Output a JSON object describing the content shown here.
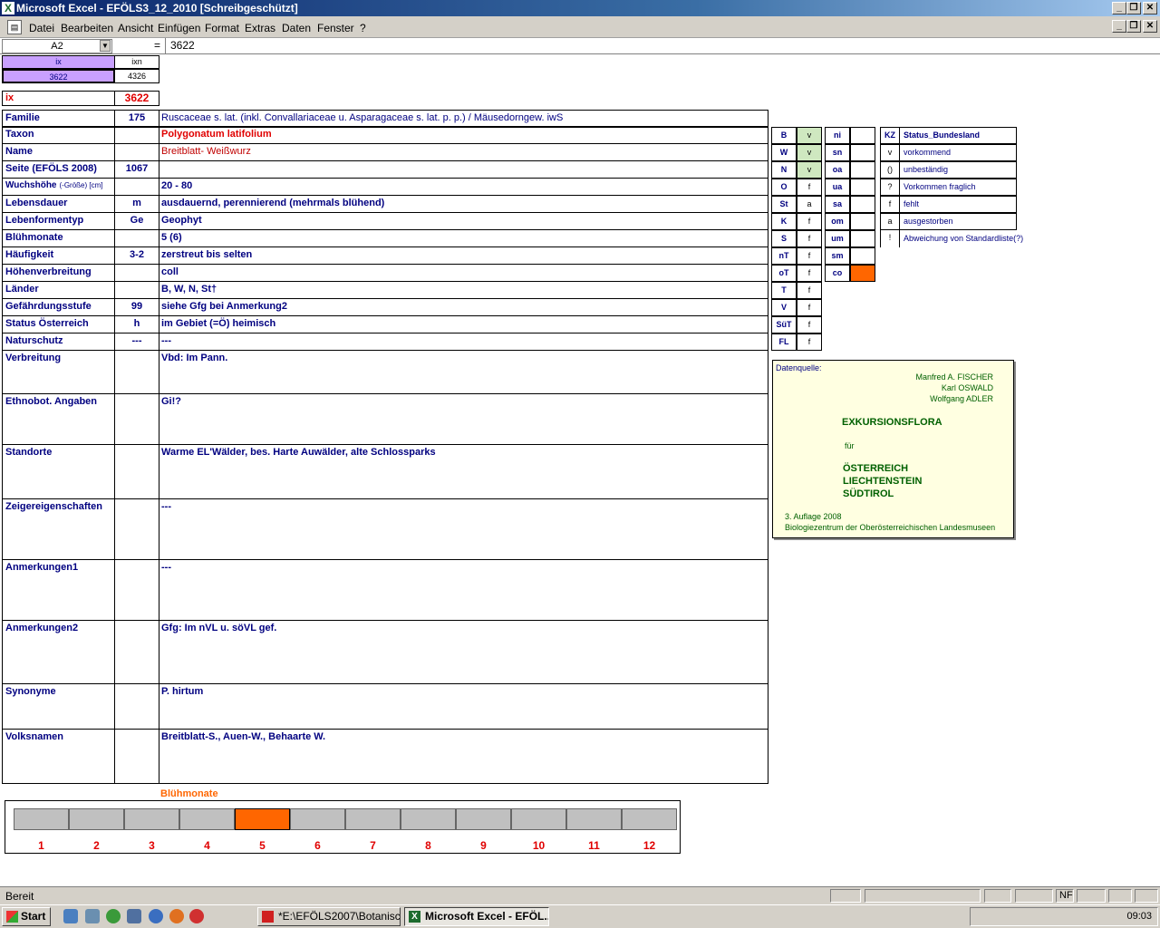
{
  "window": {
    "title": "Microsoft Excel - EFÖLS3_12_2010  [Schreibgeschützt]"
  },
  "menu": [
    "Datei",
    "Bearbeiten",
    "Ansicht",
    "Einfügen",
    "Format",
    "Extras",
    "Daten",
    "Fenster",
    "?"
  ],
  "formula": {
    "cell": "A2",
    "eq": "=",
    "value": "3622"
  },
  "header": {
    "ix_label": "ix",
    "ixn_label": "ixn",
    "ix_val": "3622",
    "ixn_val": "4326",
    "ix2_label": "ix",
    "ix2_val": "3622"
  },
  "rows": [
    {
      "label": "Familie",
      "code": "175",
      "value": "Ruscaceae s. lat. (inkl. Convallariaceae u. Asparagaceae s. lat. p. p.)  /  Mäusedorngew. iwS"
    },
    {
      "label": "Taxon",
      "code": "",
      "value": "Polygonatum latifolium"
    },
    {
      "label": "Name",
      "code": "",
      "value": "Breitblatt- Weißwurz"
    },
    {
      "label": "Seite (EFÖLS 2008)",
      "code": "1067",
      "value": ""
    },
    {
      "label": "Wuchshöhe",
      "label_suffix": "(-Größe) [cm]",
      "code": "",
      "value": "20 - 80"
    },
    {
      "label": "Lebensdauer",
      "code": "m",
      "value": "ausdauernd, perennierend (mehrmals blühend)"
    },
    {
      "label": "Lebenformentyp",
      "code": "Ge",
      "value": "Geophyt"
    },
    {
      "label": "Blühmonate",
      "code": "",
      "value": "5 (6)"
    },
    {
      "label": "Häufigkeit",
      "code": "3-2",
      "value": "zerstreut bis selten"
    },
    {
      "label": "Höhenverbreitung",
      "code": "",
      "value": "coll"
    },
    {
      "label": "Länder",
      "code": "",
      "value": "B, W, N, St†"
    },
    {
      "label": "Gefährdungsstufe",
      "code": "99",
      "value": "siehe Gfg bei Anmerkung2"
    },
    {
      "label": "Status Österreich",
      "code": "h",
      "value": "im Gebiet (=Ö) heimisch"
    },
    {
      "label": "Naturschutz",
      "code": "---",
      "value": "---"
    }
  ],
  "blocks": [
    {
      "label": "Verbreitung",
      "value": "Vbd:  Im Pann."
    },
    {
      "label": "Ethnobot. Angaben",
      "value": " Gi!?"
    },
    {
      "label": "Standorte",
      "value": "Warme EL'Wälder, bes. Harte Auwälder, alte Schlossparks"
    },
    {
      "label": "Zeigereigenschaften",
      "value": "---"
    },
    {
      "label": "Anmerkungen1",
      "value": "---"
    },
    {
      "label": "Anmerkungen2",
      "value": "Gfg: Im nVL u. söVL gef."
    },
    {
      "label": "Synonyme",
      "value": "P. hirtum"
    },
    {
      "label": "Volksnamen",
      "value": "Breitblatt-S., Auen-W., Behaarte W."
    }
  ],
  "laender": [
    {
      "code": "B",
      "status": "v"
    },
    {
      "code": "W",
      "status": "v"
    },
    {
      "code": "N",
      "status": "v"
    },
    {
      "code": "O",
      "status": "f"
    },
    {
      "code": "St",
      "status": "a"
    },
    {
      "code": "K",
      "status": "f"
    },
    {
      "code": "S",
      "status": "f"
    },
    {
      "code": "nT",
      "status": "f"
    },
    {
      "code": "oT",
      "status": "f"
    },
    {
      "code": "T",
      "status": "f"
    },
    {
      "code": "V",
      "status": "f"
    },
    {
      "code": "SüT",
      "status": "f"
    },
    {
      "code": "FL",
      "status": "f"
    }
  ],
  "regionen": [
    "ni",
    "sn",
    "oa",
    "ua",
    "sa",
    "om",
    "um",
    "sm",
    "co"
  ],
  "legend": {
    "head_kz": "KZ",
    "head_status": "Status_Bundesland",
    "items": [
      {
        "kz": "v",
        "text": "vorkommend"
      },
      {
        "kz": "()",
        "text": "unbeständig"
      },
      {
        "kz": "?",
        "text": "Vorkommen fraglich"
      },
      {
        "kz": "f",
        "text": "fehlt"
      },
      {
        "kz": "a",
        "text": "ausgestorben"
      },
      {
        "kz": "!",
        "text": "Abweichung von Standardliste(?)"
      }
    ]
  },
  "datenquelle": {
    "heading": "Datenquelle:",
    "author1": "Manfred A. FISCHER",
    "author2": "Karl OSWALD",
    "author3": "Wolfgang ADLER",
    "title": "EXKURSIONSFLORA",
    "fuer": "für",
    "country1": "ÖSTERREICH",
    "country2": "LIECHTENSTEIN",
    "country3": "SÜDTIROL",
    "edition": "3. Auflage 2008",
    "publisher": "Biologiezentrum der Oberösterreichischen Landesmuseen"
  },
  "chart_title": "Blühmonate",
  "months": [
    "1",
    "2",
    "3",
    "4",
    "5",
    "6",
    "7",
    "8",
    "9",
    "10",
    "11",
    "12"
  ],
  "active_months": [
    5
  ],
  "statusbar": {
    "text": "Bereit",
    "nf": "NF"
  },
  "taskbar": {
    "start": "Start",
    "task1": "*E:\\EFÖLS2007\\Botanisc...",
    "task2": "Microsoft Excel - EFÖL...",
    "clock": "09:03"
  },
  "colors": {
    "titlebar": "#0a246a",
    "label": "#000080",
    "red": "#e00000",
    "orange": "#ff6600",
    "legend_bg": "#ffffe1",
    "green_bg": "#cfe8c0"
  }
}
